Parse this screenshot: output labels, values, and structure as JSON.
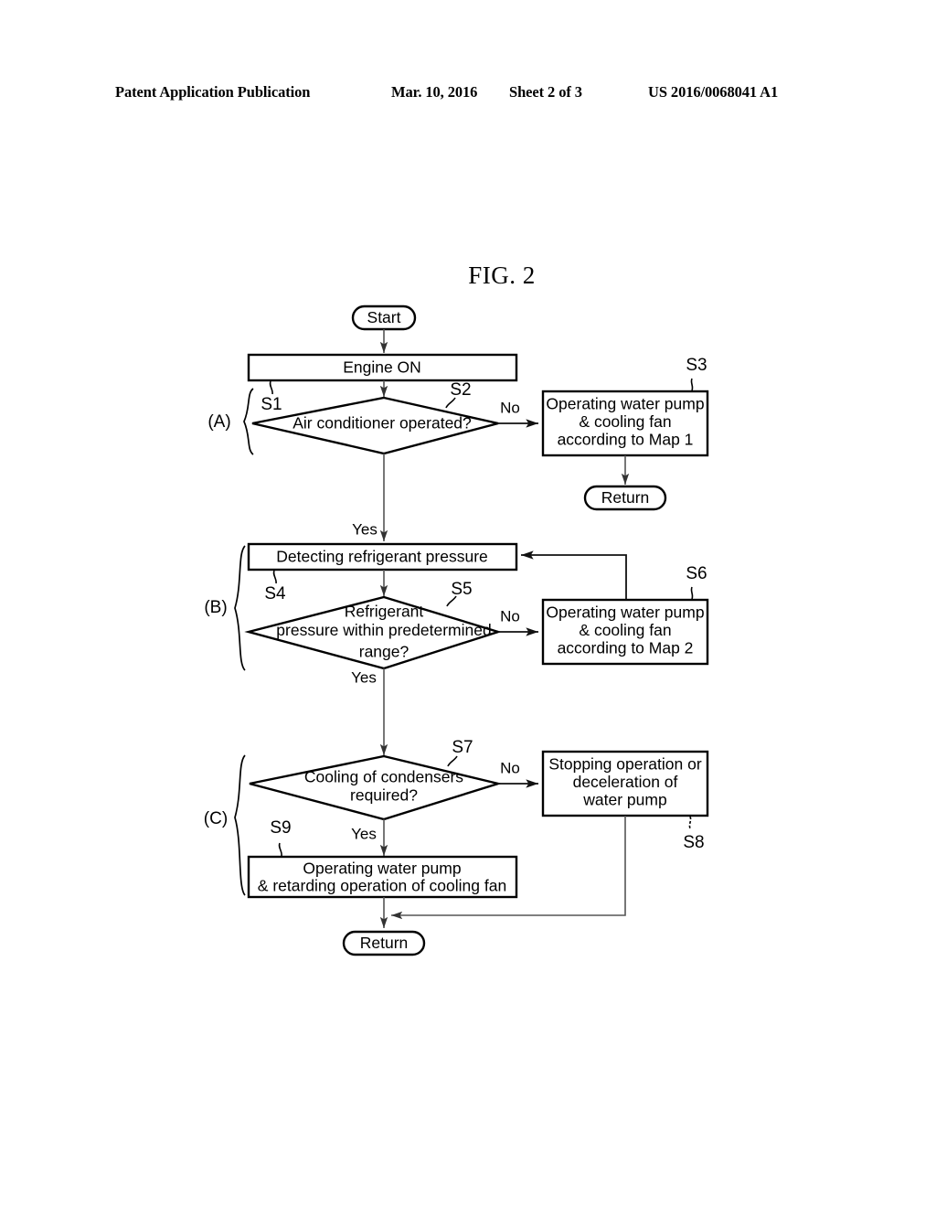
{
  "header": {
    "publication": "Patent Application Publication",
    "date": "Mar. 10, 2016",
    "sheet": "Sheet 2 of 3",
    "number": "US 2016/0068041 A1"
  },
  "figure": {
    "title": "FIG. 2"
  },
  "flowchart": {
    "nodes": {
      "start": {
        "label": "Start",
        "type": "terminator"
      },
      "engine_on": {
        "label": "Engine ON",
        "type": "process",
        "ref": "S1"
      },
      "ac_decision": {
        "label": "Air conditioner operated?",
        "type": "decision",
        "ref": "S2"
      },
      "map1": {
        "line1": "Operating water pump",
        "line2": "& cooling fan",
        "line3": "according to Map 1",
        "type": "process",
        "ref": "S3"
      },
      "return_top": {
        "label": "Return",
        "type": "terminator"
      },
      "detect_pressure": {
        "label": "Detecting refrigerant pressure",
        "type": "process",
        "ref": "S4"
      },
      "pressure_decision": {
        "line1": "Refrigerant",
        "line2": "pressure within predetermined",
        "line3": "range?",
        "type": "decision",
        "ref": "S5"
      },
      "map2": {
        "line1": "Operating water pump",
        "line2": "& cooling fan",
        "line3": "according to Map 2",
        "type": "process",
        "ref": "S6"
      },
      "condenser_decision": {
        "line1": "Cooling of condensers",
        "line2": "required?",
        "type": "decision",
        "ref": "S7"
      },
      "stop_pump": {
        "line1": "Stopping operation or",
        "line2": "deceleration of",
        "line3": "water pump",
        "type": "process",
        "ref": "S8"
      },
      "retard_fan": {
        "line1": "Operating water pump",
        "line2": "& retarding operation of cooling fan",
        "type": "process",
        "ref": "S9"
      },
      "return_bottom": {
        "label": "Return",
        "type": "terminator"
      }
    },
    "edge_labels": {
      "ac_no": "No",
      "ac_yes": "Yes",
      "pressure_no": "No",
      "pressure_yes": "Yes",
      "condenser_no": "No",
      "condenser_yes": "Yes"
    },
    "groups": [
      {
        "label": "(A)"
      },
      {
        "label": "(B)"
      },
      {
        "label": "(C)"
      }
    ],
    "colors": {
      "stroke": "#000000",
      "flowline": "#555555",
      "background": "#ffffff"
    }
  }
}
